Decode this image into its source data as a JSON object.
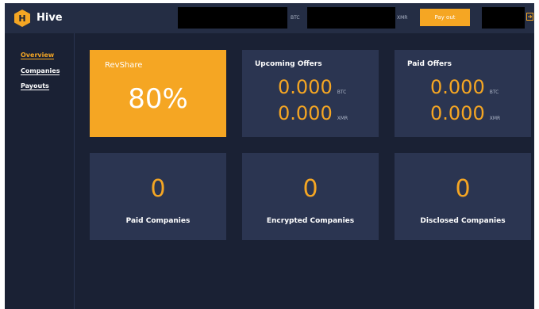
{
  "app": {
    "logo_letter": "H",
    "brand": "Hive"
  },
  "topbar": {
    "btc_unit": "BTC",
    "xmr_unit": "XMR",
    "payout_label": "Pay out"
  },
  "sidebar": {
    "items": [
      {
        "label": "Overview"
      },
      {
        "label": "Companies"
      },
      {
        "label": "Payouts"
      }
    ]
  },
  "revshare": {
    "title": "RevShare",
    "value": "80%"
  },
  "upcoming_offers": {
    "title": "Upcoming Offers",
    "btc_amount": "0.000",
    "btc_unit": "BTC",
    "xmr_amount": "0.000",
    "xmr_unit": "XMR"
  },
  "paid_offers": {
    "title": "Paid Offers",
    "btc_amount": "0.000",
    "btc_unit": "BTC",
    "xmr_amount": "0.000",
    "xmr_unit": "XMR"
  },
  "stats": {
    "paid_companies": {
      "value": "0",
      "label": "Paid Companies"
    },
    "encrypted_companies": {
      "value": "0",
      "label": "Encrypted Companies"
    },
    "disclosed_companies": {
      "value": "0",
      "label": "Disclosed Companies"
    }
  },
  "colors": {
    "accent": "#f5a623",
    "background": "#1a2134",
    "card": "#2b3551",
    "topbar": "#242d44"
  },
  "icons": {
    "logo": "hexagon-logo-icon",
    "logout": "logout-icon"
  }
}
